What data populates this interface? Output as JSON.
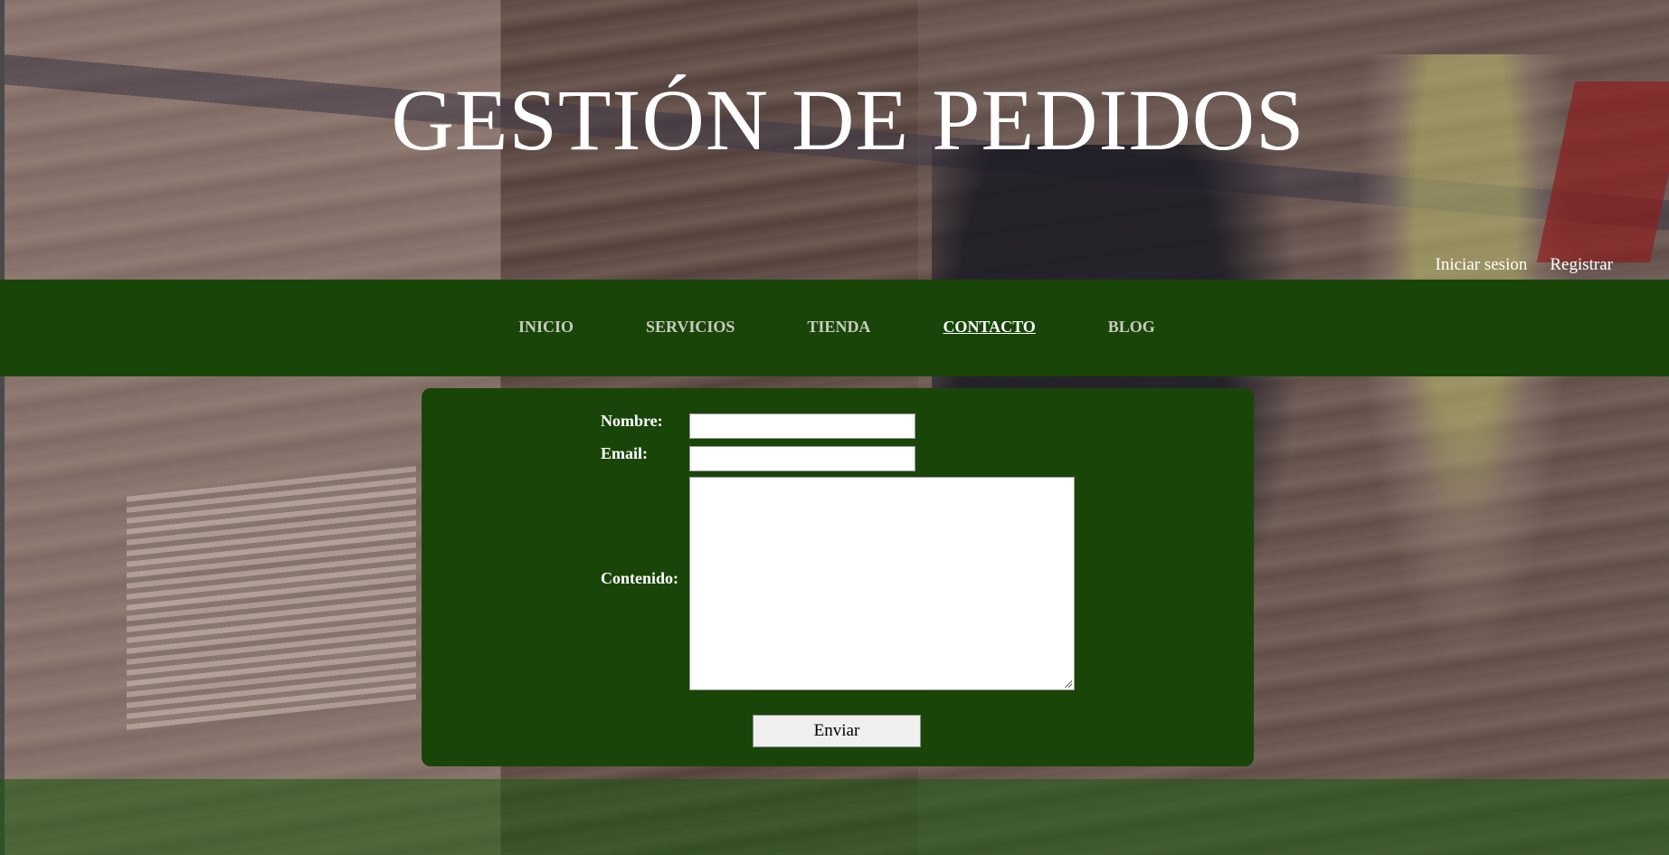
{
  "header": {
    "title": "GESTIÓN DE PEDIDOS",
    "auth": {
      "login": "Iniciar sesion",
      "register": "Registrar"
    }
  },
  "nav": {
    "items": [
      {
        "label": "INICIO",
        "active": false
      },
      {
        "label": "SERVICIOS",
        "active": false
      },
      {
        "label": "TIENDA",
        "active": false
      },
      {
        "label": "CONTACTO",
        "active": true
      },
      {
        "label": "BLOG",
        "active": false
      }
    ]
  },
  "contact_form": {
    "name_label": "Nombre:",
    "name_value": "",
    "email_label": "Email:",
    "email_value": "",
    "content_label": "Contenido:",
    "content_value": "",
    "submit_label": "Enviar"
  },
  "colors": {
    "nav_bg": "#1a4509",
    "panel_bg": "#1a4509",
    "active_link": "#ffffff",
    "inactive_link": "#c7ccc0"
  }
}
